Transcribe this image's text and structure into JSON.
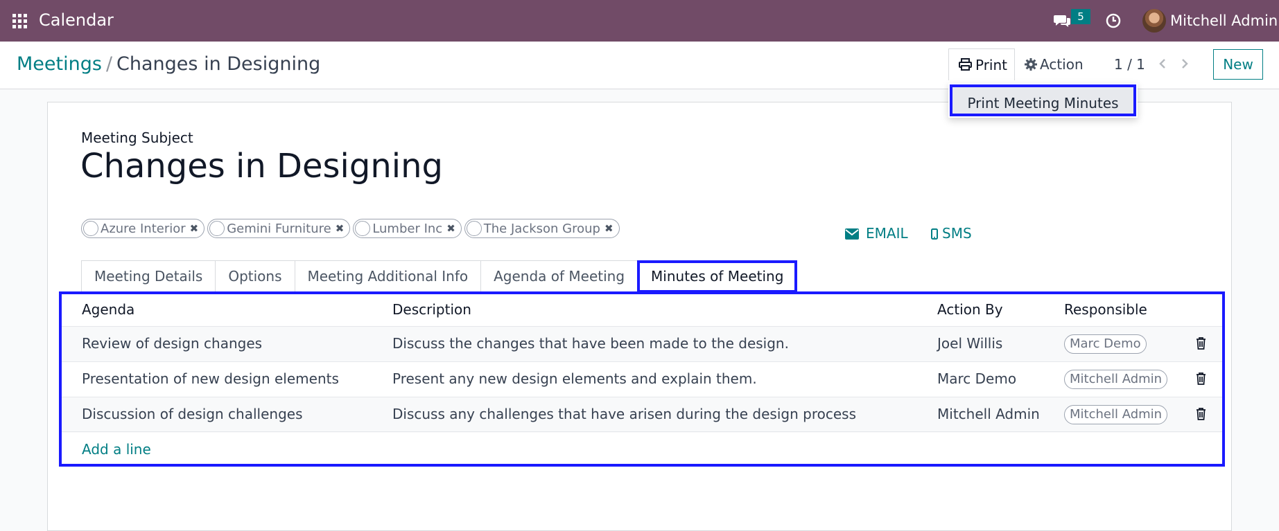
{
  "navbar": {
    "app_title": "Calendar",
    "message_count": "5",
    "user_name": "Mitchell Admin",
    "icons": [
      "apps-grid-icon",
      "chat-icon",
      "clock-icon"
    ]
  },
  "breadcrumb": {
    "parent": "Meetings",
    "separator": "/",
    "current": "Changes in Designing"
  },
  "toolbar": {
    "print_label": "Print",
    "action_label": "Action",
    "pager": "1 / 1",
    "new_label": "New"
  },
  "print_menu": {
    "items": [
      "Print Meeting Minutes"
    ]
  },
  "form": {
    "subject_label": "Meeting Subject",
    "subject": "Changes in Designing",
    "attendees": [
      "Azure Interior",
      "Gemini Furniture",
      "Lumber Inc",
      "The Jackson Group"
    ],
    "email_label": "EMAIL",
    "sms_label": "SMS"
  },
  "tabs": [
    {
      "label": "Meeting Details",
      "active": false
    },
    {
      "label": "Options",
      "active": false
    },
    {
      "label": "Meeting Additional Info",
      "active": false
    },
    {
      "label": "Agenda of Meeting",
      "active": false
    },
    {
      "label": "Minutes of Meeting",
      "active": true
    }
  ],
  "minutes_table": {
    "columns": [
      "Agenda",
      "Description",
      "Action By",
      "Responsible"
    ],
    "rows": [
      {
        "agenda": "Review of design changes",
        "description": "Discuss the changes that have been made to the design.",
        "action_by": "Joel Willis",
        "responsible": "Marc Demo"
      },
      {
        "agenda": "Presentation of new design elements",
        "description": "Present any new design elements and explain them.",
        "action_by": "Marc Demo",
        "responsible": "Mitchell Admin"
      },
      {
        "agenda": "Discussion of design challenges",
        "description": "Discuss any challenges that have arisen during the design process",
        "action_by": "Mitchell Admin",
        "responsible": "Mitchell Admin"
      }
    ],
    "add_line_label": "Add a line"
  },
  "colors": {
    "navbar": "#714b67",
    "accent": "#017e84",
    "highlight": "#1a1aff"
  }
}
